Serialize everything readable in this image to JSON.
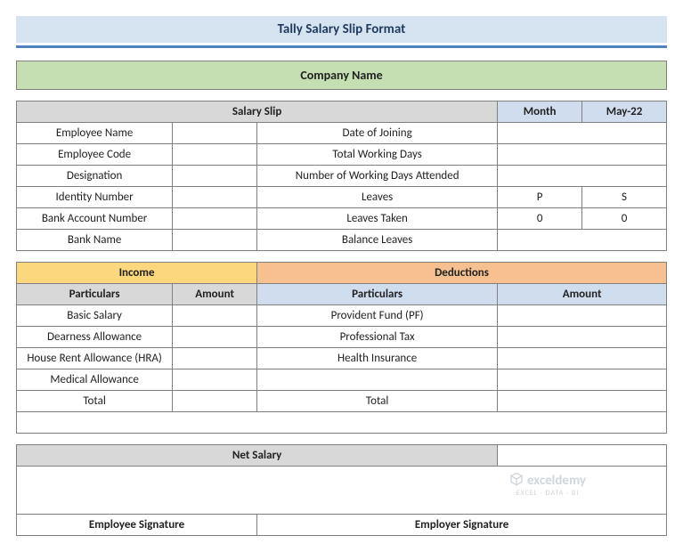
{
  "title": "Tally Salary Slip Format",
  "company_label": "Company Name",
  "slip": {
    "header": "Salary Slip",
    "month_label": "Month",
    "month_value": "May-22",
    "rows": [
      {
        "left": "Employee Name",
        "mid": "Date of Joining",
        "c1": "",
        "c2": ""
      },
      {
        "left": "Employee Code",
        "mid": "Total Working Days",
        "c1": "",
        "c2": ""
      },
      {
        "left": "Designation",
        "mid": "Number of Working Days Attended",
        "c1": "",
        "c2": ""
      },
      {
        "left": "Identity Number",
        "mid": "Leaves",
        "c1": "P",
        "c2": "S"
      },
      {
        "left": "Bank Account Number",
        "mid": "Leaves Taken",
        "c1": "0",
        "c2": "0"
      },
      {
        "left": "Bank Name",
        "mid": "Balance Leaves",
        "c1": "",
        "c2": ""
      }
    ]
  },
  "income": {
    "header": "Income",
    "particulars_label": "Particulars",
    "amount_label": "Amount",
    "items": [
      "Basic Salary",
      "Dearness Allowance",
      "House Rent Allowance (HRA)",
      "Medical Allowance",
      "Total"
    ]
  },
  "deductions": {
    "header": "Deductions",
    "particulars_label": "Particulars",
    "amount_label": "Amount",
    "items": [
      "Provident Fund (PF)",
      "Professional Tax",
      "Health Insurance",
      "",
      "Total"
    ]
  },
  "net_salary_label": "Net Salary",
  "signatures": {
    "employee": "Employee Signature",
    "employer": "Employer Signature"
  },
  "watermark": {
    "brand": "exceldemy",
    "sub": "EXCEL · DATA · BI"
  }
}
